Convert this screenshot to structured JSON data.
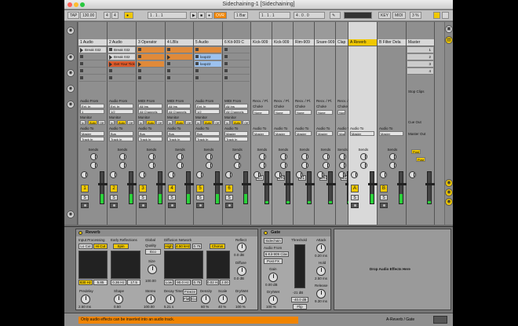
{
  "window": {
    "title": "Sidechaining-1  [Sidechaining]"
  },
  "toolbar": {
    "tap": "TAP",
    "tempo": "130.00",
    "sig_num": "4",
    "sig_den": "4",
    "ovr": "OVR",
    "bar": "1 Bar",
    "pos1": "1 . 1 . 1",
    "pos2": "1 . 1 . 1",
    "pos3": "4 . 0 . 0",
    "key": "KEY",
    "midi": "MIDI",
    "cpu": "3 %"
  },
  "tracks": [
    {
      "name": "1 Audio",
      "clips": [
        [
          "Break 032",
          "clip",
          1
        ],
        [
          "",
          "",
          0
        ],
        [
          "",
          "",
          0
        ],
        [
          "",
          "",
          0
        ]
      ],
      "input": "Ext. In",
      "input_ch": "1",
      "monitor_sel": "Auto",
      "audio_to": "Master",
      "num": "1",
      "kind": "audio"
    },
    {
      "name": "2 Audio",
      "clips": [
        [
          "Break 032",
          "clip",
          0
        ],
        [
          "Break 032",
          "clip",
          1
        ],
        [
          "Get Your Tick",
          "rd",
          1
        ],
        [
          "",
          "",
          0
        ]
      ],
      "input": "Ext. In",
      "input_ch": "1/2",
      "monitor_sel": "Auto",
      "audio_to": "Bus",
      "num": "2",
      "kind": "audio"
    },
    {
      "name": "3 Operator",
      "clips": [
        [
          "",
          "or",
          0
        ],
        [
          "",
          "or",
          0
        ],
        [
          "",
          "or",
          1
        ],
        [
          "",
          "",
          0
        ]
      ],
      "input": "All Ins",
      "input_ch": "All Channels",
      "monitor_sel": "Auto",
      "audio_to": "Bus",
      "num": "3",
      "kind": "midi"
    },
    {
      "name": "4 LBIs",
      "clips": [
        [
          "",
          "or",
          0
        ],
        [
          "",
          "or",
          1
        ],
        [
          "",
          "",
          0
        ],
        [
          "",
          "",
          0
        ]
      ],
      "input": "All Ins",
      "input_ch": "All Channels",
      "monitor_sel": "Auto",
      "audio_to": "Bus",
      "num": "4",
      "kind": "midi"
    },
    {
      "name": "5 Audio",
      "clips": [
        [
          "",
          "or",
          0
        ],
        [
          "loop22",
          "bl",
          0
        ],
        [
          "loop22",
          "bl",
          0
        ],
        [
          "",
          "",
          0
        ]
      ],
      "input": "Ext. In",
      "input_ch": "1/2",
      "monitor_sel": "Auto",
      "audio_to": "Bus",
      "num": "5",
      "kind": "audio"
    },
    {
      "name": "6 Kit-909 C",
      "clips": [
        [
          "",
          "",
          0
        ],
        [
          "",
          "",
          0
        ],
        [
          "",
          "",
          0
        ],
        [
          "",
          "",
          0
        ]
      ],
      "input": "All Ins",
      "input_ch": "All Channels",
      "monitor_sel": "Auto",
      "audio_to": "Master",
      "num": "6",
      "kind": "midi"
    },
    {
      "name": "Kick-909",
      "clips": [],
      "input": "Kick-909",
      "input_ch": "",
      "monitor_sel": "",
      "audio_to": "",
      "num": "",
      "kind": "chain"
    },
    {
      "name": "Kick-909",
      "clips": [],
      "input": "",
      "input_ch": "",
      "monitor_sel": "",
      "audio_to": "",
      "num": "",
      "kind": "chain"
    },
    {
      "name": "Rim-909",
      "clips": [],
      "input": "",
      "input_ch": "",
      "monitor_sel": "",
      "audio_to": "",
      "num": "",
      "kind": "chain"
    },
    {
      "name": "Snare-909",
      "clips": [],
      "input": "",
      "input_ch": "",
      "monitor_sel": "",
      "audio_to": "",
      "num": "",
      "kind": "chain"
    },
    {
      "name": "Clap",
      "clips": [],
      "input": "",
      "input_ch": "",
      "monitor_sel": "",
      "audio_to": "",
      "num": "",
      "kind": "chain"
    },
    {
      "name": "A Reverb",
      "clips": [],
      "input": "",
      "input_ch": "",
      "monitor_sel": "",
      "audio_to": "Master",
      "num": "A",
      "kind": "return"
    },
    {
      "name": "B Filter Dela",
      "clips": [],
      "input": "",
      "input_ch": "",
      "monitor_sel": "",
      "audio_to": "Master",
      "num": "B",
      "kind": "return"
    },
    {
      "name": "Master",
      "clips": [],
      "input": "",
      "input_ch": "",
      "monitor_sel": "",
      "audio_to": "",
      "num": "",
      "kind": "master"
    }
  ],
  "labels": {
    "audio_from": "Audio From",
    "midi_from": "MIDI From",
    "monitor": "Monitor",
    "in": "In",
    "auto": "Auto",
    "off": "Off",
    "audio_to": "Audio To",
    "sends": "Sends",
    "recv": "Recv. / Pl.",
    "choke": "Choke",
    "none": "None",
    "track_in": "Track In",
    "cue_out": "Cue Out",
    "master_out": "Master Out",
    "stop_clips": "Stop Clips",
    "post": "Post",
    "audio_to_master": "Master"
  },
  "master_scenes": [
    "1",
    "2",
    "3",
    "4"
  ],
  "chain_notes": [
    "C1",
    "C#1",
    "D1",
    "D#1",
    "E1"
  ],
  "reverb": {
    "title": "Reverb",
    "input_processing": "Input Processing",
    "lo_cut": "Lo Cut",
    "hi_cut": "Hi Cut",
    "early_reflections": "Early Reflections",
    "spin": "Spin",
    "global": "Global",
    "quality": "Quality",
    "quality_val": "Eco",
    "size": "Size",
    "size_val": "100.00",
    "diffusion_network": "Diffusion Network",
    "high": "High",
    "high_val": "4.50 kHz",
    "scale_val": "0.75",
    "chorus": "Chorus",
    "reflect": "Reflect",
    "diffuse": "Diffuse",
    "reflect_db": "0.0 dB",
    "diffuse_db": "0.0 dB",
    "freq_val": "830 Hz",
    "q_val": "5.85",
    "hz1": "0.36 Hz",
    "er_val": "17.5",
    "low": "Low",
    "low_val": "90.0 Hz",
    "low2": "0.75",
    "chorus1": "0.02 Hz",
    "chorus2": "2.00",
    "predelay": "Predelay",
    "predelay_val": "2.50 ms",
    "shape": "Shape",
    "shape_val": "0.50",
    "stereo": "Stereo",
    "stereo_val": "100.00",
    "decay": "Decay Time",
    "decay_val": "5.21 s",
    "freeze": "Freeze",
    "flat": "Flat",
    "cut": "Cut",
    "density": "Density",
    "density_val": "60 %",
    "scale": "Scale",
    "scale2": "40 %",
    "drywet": "Dry/Wet",
    "drywet_val": "100 %"
  },
  "gate": {
    "title": "Gate",
    "sidechain": "Sidechain",
    "audio_from": "Audio From",
    "source": "6-Kit-909 Clav",
    "post": "Post FX",
    "gain": "Gain",
    "gain_val": "0.00 dB",
    "drywet": "Dry/Wet",
    "drywet_val": "100 %",
    "threshold": "Threshold",
    "thr_db": "-21 dB",
    "thr_val": "-40.0 dB",
    "flip": "Flip",
    "attack": "Attack",
    "attack_val": "0.20 ms",
    "hold": "Hold",
    "hold_val": "2.50 ms",
    "release": "Release",
    "release_val": "9.30 ms"
  },
  "drop_text": "Drop Audio Effects Here",
  "status": {
    "message": "Only audio effects can be inserted into an audio track.",
    "right": "A-Reverb / Gate"
  }
}
